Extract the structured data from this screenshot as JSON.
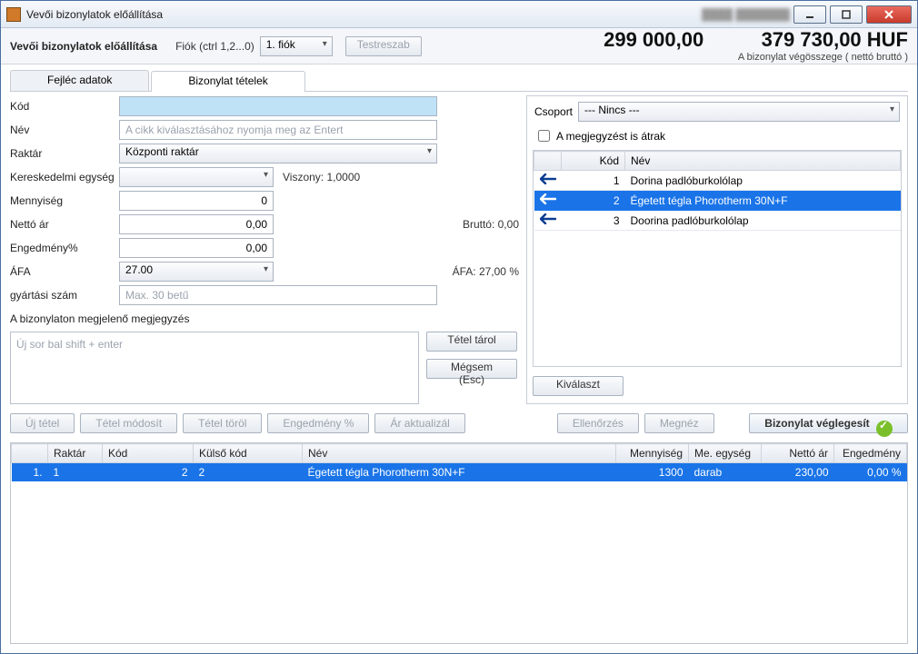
{
  "window": {
    "title": "Vevői bizonylatok előállítása"
  },
  "toolbar": {
    "heading": "Vevői bizonylatok előállítása",
    "drawer_label": "Fiók (ctrl 1,2...0)",
    "drawer_value": "1. fiók",
    "customize": "Testreszab"
  },
  "totals": {
    "net": "299 000,00",
    "gross": "379 730,00 HUF",
    "caption": "A bizonylat végösszege ( nettó bruttó )"
  },
  "tabs": {
    "header": "Fejléc adatok",
    "items": "Bizonylat tételek"
  },
  "form": {
    "code_label": "Kód",
    "name_label": "Név",
    "name_placeholder": "A cikk kiválasztásához nyomja meg az Entert",
    "warehouse_label": "Raktár",
    "warehouse_value": "Központi raktár",
    "unit_label": "Kereskedelmi egység",
    "ratio_label": "Viszony: 1,0000",
    "qty_label": "Mennyiség",
    "qty_value": "0",
    "net_label": "Nettó ár",
    "net_value": "0,00",
    "gross_info": "Bruttó: 0,00",
    "discount_label": "Engedmény%",
    "discount_value": "0,00",
    "vat_label": "ÁFA",
    "vat_value": "27.00",
    "vat_info": "ÁFA: 27,00 %",
    "serial_label": "gyártási szám",
    "serial_placeholder": "Max. 30 betű",
    "comment_label": "A bizonylaton megjelenő megjegyzés",
    "comment_placeholder": "Új sor bal shift + enter",
    "store_btn": "Tétel tárol",
    "cancel_btn": "Mégsem (Esc)"
  },
  "side": {
    "group_label": "Csoport",
    "group_value": "--- Nincs ---",
    "carry_comment": "A megjegyzést is átrak",
    "col_code": "Kód",
    "col_name": "Név",
    "rows": [
      {
        "code": "1",
        "name": "Dorina padlóburkolólap",
        "selected": false
      },
      {
        "code": "2",
        "name": "Égetett tégla Phorotherm 30N+F",
        "selected": true
      },
      {
        "code": "3",
        "name": "Doorina padlóburkolólap",
        "selected": false
      }
    ],
    "select_btn": "Kiválaszt"
  },
  "actions": {
    "new_item": "Új tétel",
    "edit_item": "Tétel módosít",
    "delete_item": "Tétel töröl",
    "discount_pct": "Engedmény %",
    "update_price": "Ár aktualizál",
    "check": "Ellenőrzés",
    "preview": "Megnéz",
    "finalize": "Bizonylat véglegesít"
  },
  "grid": {
    "cols": {
      "idx": "",
      "warehouse": "Raktár",
      "code": "Kód",
      "ext_code": "Külső kód",
      "name": "Név",
      "qty": "Mennyiség",
      "unit": "Me. egység",
      "net": "Nettó ár",
      "discount": "Engedmény"
    },
    "rows": [
      {
        "idx": "1.",
        "warehouse": "1",
        "code": "2",
        "ext_code": "2",
        "name": "Égetett tégla Phorotherm 30N+F",
        "qty": "1300",
        "unit": "darab",
        "net": "230,00",
        "discount": "0,00 %"
      }
    ]
  }
}
